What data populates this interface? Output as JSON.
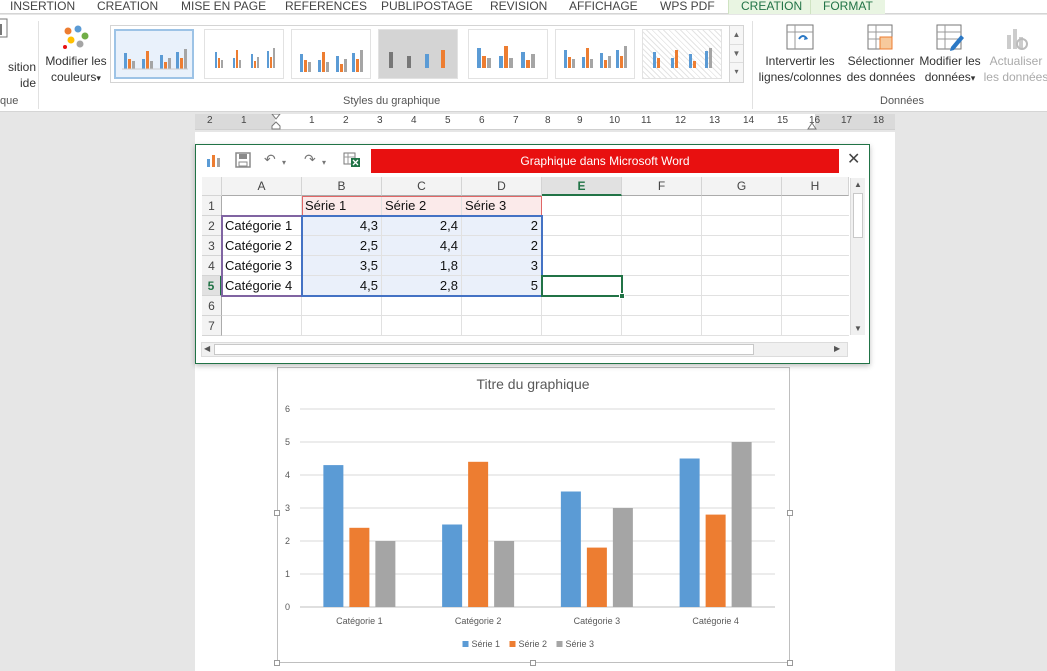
{
  "ribbon": {
    "tabs": [
      "INSERTION",
      "CREATION",
      "MISE EN PAGE",
      "REFERENCES",
      "PUBLIPOSTAGE",
      "REVISION",
      "AFFICHAGE",
      "WPS PDF",
      "CREATION",
      "FORMAT"
    ],
    "partial_left_line1": "sition",
    "partial_left_line2": "ide",
    "partial_left_group": "que",
    "colors_btn_line1": "Modifier les",
    "colors_btn_line2": "couleurs",
    "styles_group_label": "Styles du graphique",
    "switch_btn_line1": "Intervertir les",
    "switch_btn_line2": "lignes/colonnes",
    "select_btn_line1": "Sélectionner",
    "select_btn_line2": "des données",
    "edit_btn_line1": "Modifier les",
    "edit_btn_line2": "données",
    "refresh_btn_line1": "Actualiser",
    "refresh_btn_line2": "les données",
    "data_group_label": "Données",
    "dropdown_arrow": "▾"
  },
  "ruler": {
    "numbers": [
      "2",
      "1",
      "1",
      "2",
      "3",
      "4",
      "5",
      "6",
      "7",
      "8",
      "9",
      "10",
      "11",
      "12",
      "13",
      "14",
      "15",
      "16",
      "17",
      "18"
    ]
  },
  "spreadsheet": {
    "title": "Graphique dans Microsoft Word",
    "close_glyph": "✕",
    "undo_glyph": "↶",
    "redo_glyph": "↷",
    "columns": [
      "A",
      "B",
      "C",
      "D",
      "E",
      "F",
      "G",
      "H"
    ],
    "rows": [
      "1",
      "2",
      "3",
      "4",
      "5",
      "6",
      "7"
    ],
    "header_row": [
      "",
      "Série 1",
      "Série 2",
      "Série 3"
    ],
    "data_rows": [
      [
        "Catégorie 1",
        "4,3",
        "2,4",
        "2"
      ],
      [
        "Catégorie 2",
        "2,5",
        "4,4",
        "2"
      ],
      [
        "Catégorie 3",
        "3,5",
        "1,8",
        "3"
      ],
      [
        "Catégorie 4",
        "4,5",
        "2,8",
        "5"
      ]
    ],
    "active_column": "E",
    "active_row": "5"
  },
  "chart_data": {
    "type": "bar",
    "title": "Titre du graphique",
    "categories": [
      "Catégorie 1",
      "Catégorie 2",
      "Catégorie 3",
      "Catégorie 4"
    ],
    "series": [
      {
        "name": "Série 1",
        "values": [
          4.3,
          2.5,
          3.5,
          4.5
        ],
        "color": "#5b9bd5"
      },
      {
        "name": "Série 2",
        "values": [
          2.4,
          4.4,
          1.8,
          2.8
        ],
        "color": "#ed7d31"
      },
      {
        "name": "Série 3",
        "values": [
          2,
          2,
          3,
          5
        ],
        "color": "#a5a5a5"
      }
    ],
    "ylim": [
      0,
      6
    ],
    "yticks": [
      "0",
      "1",
      "2",
      "3",
      "4",
      "5",
      "6"
    ],
    "grid": true,
    "legend": "bottom"
  }
}
